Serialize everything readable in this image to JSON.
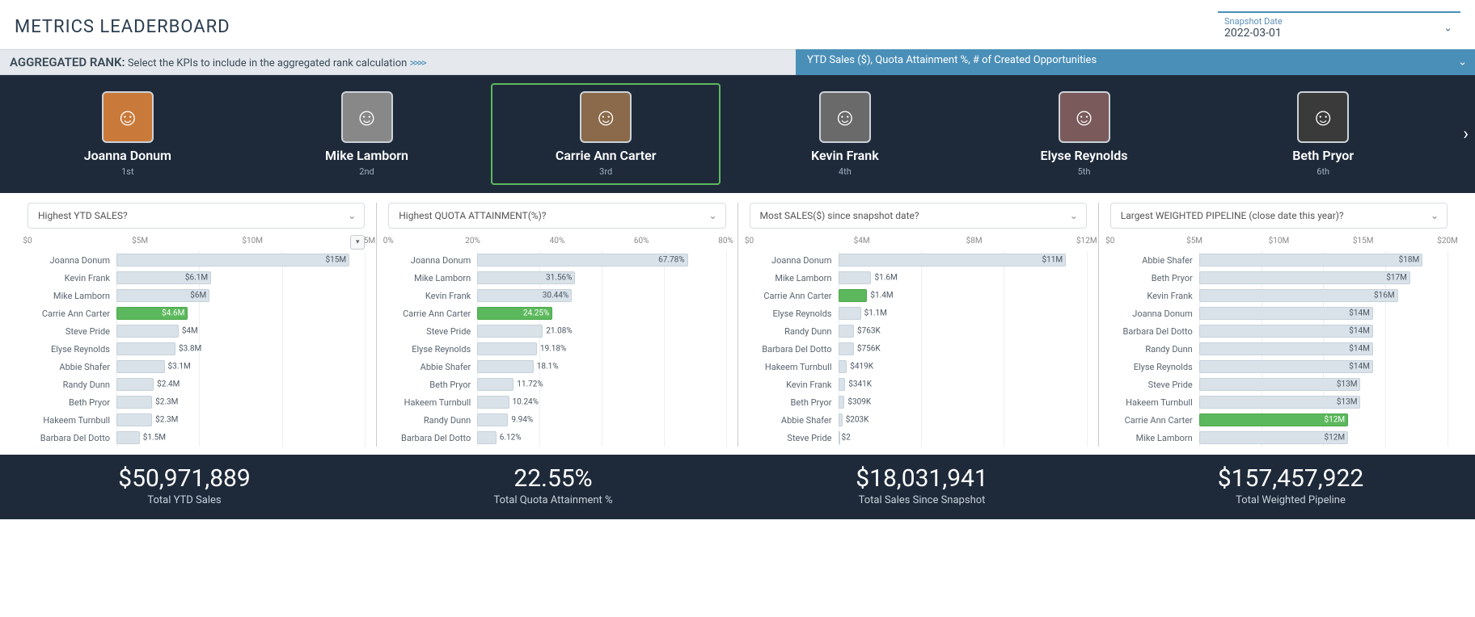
{
  "title": "METRICS LEADERBOARD",
  "snapshot": {
    "label": "Snapshot Date",
    "date": "2022-03-01"
  },
  "aggbar": {
    "heading": "AGGREGATED RANK:",
    "help": "Select the KPIs to include in the aggregated rank calculation",
    "arrows": ">>>>",
    "kpis": "YTD Sales ($), Quota Attainment %, # of Created Opportunities"
  },
  "leaders": [
    {
      "name": "Joanna Donum",
      "rank": "1st",
      "avatar_bg": "#c97a3a",
      "highlight": false
    },
    {
      "name": "Mike Lamborn",
      "rank": "2nd",
      "avatar_bg": "#888888",
      "highlight": false
    },
    {
      "name": "Carrie Ann Carter",
      "rank": "3rd",
      "avatar_bg": "#8a6a4a",
      "highlight": true
    },
    {
      "name": "Kevin Frank",
      "rank": "4th",
      "avatar_bg": "#6a6a6a",
      "highlight": false
    },
    {
      "name": "Elyse Reynolds",
      "rank": "5th",
      "avatar_bg": "#7a5a5a",
      "highlight": false
    },
    {
      "name": "Beth Pryor",
      "rank": "6th",
      "avatar_bg": "#3a3a3a",
      "highlight": false
    }
  ],
  "columns": [
    {
      "selector": "Highest YTD SALES?",
      "selector_has_menu_btn": true,
      "total_value": "$50,971,889",
      "total_label": "Total YTD Sales"
    },
    {
      "selector": "Highest QUOTA ATTAINMENT(%)?",
      "selector_has_menu_btn": false,
      "total_value": "22.55%",
      "total_label": "Total Quota Attainment %"
    },
    {
      "selector": "Most SALES($) since snapshot date?",
      "selector_has_menu_btn": false,
      "total_value": "$18,031,941",
      "total_label": "Total Sales Since Snapshot"
    },
    {
      "selector": "Largest WEIGHTED PIPELINE (close date this year)?",
      "selector_has_menu_btn": false,
      "total_value": "$157,457,922",
      "total_label": "Total Weighted Pipeline"
    }
  ],
  "chart_data": [
    {
      "type": "bar",
      "orientation": "horizontal",
      "title": "Highest YTD SALES?",
      "xlabel": "",
      "ylabel": "",
      "ticks": [
        "$0",
        "$5M",
        "$10M",
        "$15M"
      ],
      "max": 16,
      "rows": [
        {
          "name": "Joanna Donum",
          "value": 15.0,
          "label": "$15M"
        },
        {
          "name": "Kevin Frank",
          "value": 6.1,
          "label": "$6.1M"
        },
        {
          "name": "Mike Lamborn",
          "value": 6.0,
          "label": "$6M"
        },
        {
          "name": "Carrie Ann Carter",
          "value": 4.6,
          "label": "$4.6M",
          "highlight": true
        },
        {
          "name": "Steve Pride",
          "value": 4.0,
          "label": "$4M"
        },
        {
          "name": "Elyse Reynolds",
          "value": 3.8,
          "label": "$3.8M"
        },
        {
          "name": "Abbie Shafer",
          "value": 3.1,
          "label": "$3.1M"
        },
        {
          "name": "Randy Dunn",
          "value": 2.4,
          "label": "$2.4M"
        },
        {
          "name": "Beth Pryor",
          "value": 2.3,
          "label": "$2.3M"
        },
        {
          "name": "Hakeem Turnbull",
          "value": 2.3,
          "label": "$2.3M"
        },
        {
          "name": "Barbara Del Dotto",
          "value": 1.5,
          "label": "$1.5M"
        }
      ]
    },
    {
      "type": "bar",
      "orientation": "horizontal",
      "title": "Highest QUOTA ATTAINMENT(%)?",
      "xlabel": "",
      "ylabel": "",
      "ticks": [
        "0%",
        "20%",
        "40%",
        "60%",
        "80%"
      ],
      "max": 80,
      "rows": [
        {
          "name": "Joanna Donum",
          "value": 67.78,
          "label": "67.78%"
        },
        {
          "name": "Mike Lamborn",
          "value": 31.56,
          "label": "31.56%"
        },
        {
          "name": "Kevin Frank",
          "value": 30.44,
          "label": "30.44%"
        },
        {
          "name": "Carrie Ann Carter",
          "value": 24.25,
          "label": "24.25%",
          "highlight": true
        },
        {
          "name": "Steve Pride",
          "value": 21.08,
          "label": "21.08%"
        },
        {
          "name": "Elyse Reynolds",
          "value": 19.18,
          "label": "19.18%"
        },
        {
          "name": "Abbie Shafer",
          "value": 18.1,
          "label": "18.1%"
        },
        {
          "name": "Beth Pryor",
          "value": 11.72,
          "label": "11.72%"
        },
        {
          "name": "Hakeem Turnbull",
          "value": 10.24,
          "label": "10.24%"
        },
        {
          "name": "Randy Dunn",
          "value": 9.94,
          "label": "9.94%"
        },
        {
          "name": "Barbara Del Dotto",
          "value": 6.12,
          "label": "6.12%"
        }
      ]
    },
    {
      "type": "bar",
      "orientation": "horizontal",
      "title": "Most SALES($) since snapshot date?",
      "xlabel": "",
      "ylabel": "",
      "ticks": [
        "$0",
        "$4M",
        "$8M",
        "$12M"
      ],
      "max": 12,
      "rows": [
        {
          "name": "Joanna Donum",
          "value": 11.0,
          "label": "$11M"
        },
        {
          "name": "Mike Lamborn",
          "value": 1.6,
          "label": "$1.6M"
        },
        {
          "name": "Carrie Ann Carter",
          "value": 1.4,
          "label": "$1.4M",
          "highlight": true
        },
        {
          "name": "Elyse Reynolds",
          "value": 1.1,
          "label": "$1.1M"
        },
        {
          "name": "Randy Dunn",
          "value": 0.763,
          "label": "$763K"
        },
        {
          "name": "Barbara Del Dotto",
          "value": 0.756,
          "label": "$756K"
        },
        {
          "name": "Hakeem Turnbull",
          "value": 0.419,
          "label": "$419K"
        },
        {
          "name": "Kevin Frank",
          "value": 0.341,
          "label": "$341K"
        },
        {
          "name": "Beth Pryor",
          "value": 0.309,
          "label": "$309K"
        },
        {
          "name": "Abbie Shafer",
          "value": 0.203,
          "label": "$203K"
        },
        {
          "name": "Steve Pride",
          "value": 2e-06,
          "label": "$2"
        }
      ]
    },
    {
      "type": "bar",
      "orientation": "horizontal",
      "title": "Largest WEIGHTED PIPELINE (close date this year)?",
      "xlabel": "",
      "ylabel": "",
      "ticks": [
        "$0",
        "$5M",
        "$10M",
        "$15M",
        "$20M"
      ],
      "max": 20,
      "rows": [
        {
          "name": "Abbie Shafer",
          "value": 18.0,
          "label": "$18M"
        },
        {
          "name": "Beth Pryor",
          "value": 17.0,
          "label": "$17M"
        },
        {
          "name": "Kevin Frank",
          "value": 16.0,
          "label": "$16M"
        },
        {
          "name": "Joanna Donum",
          "value": 14.0,
          "label": "$14M"
        },
        {
          "name": "Barbara Del Dotto",
          "value": 14.0,
          "label": "$14M"
        },
        {
          "name": "Randy Dunn",
          "value": 14.0,
          "label": "$14M"
        },
        {
          "name": "Elyse Reynolds",
          "value": 14.0,
          "label": "$14M"
        },
        {
          "name": "Steve Pride",
          "value": 13.0,
          "label": "$13M"
        },
        {
          "name": "Hakeem Turnbull",
          "value": 13.0,
          "label": "$13M"
        },
        {
          "name": "Carrie Ann Carter",
          "value": 12.0,
          "label": "$12M",
          "highlight": true
        },
        {
          "name": "Mike Lamborn",
          "value": 12.0,
          "label": "$12M"
        }
      ]
    }
  ]
}
